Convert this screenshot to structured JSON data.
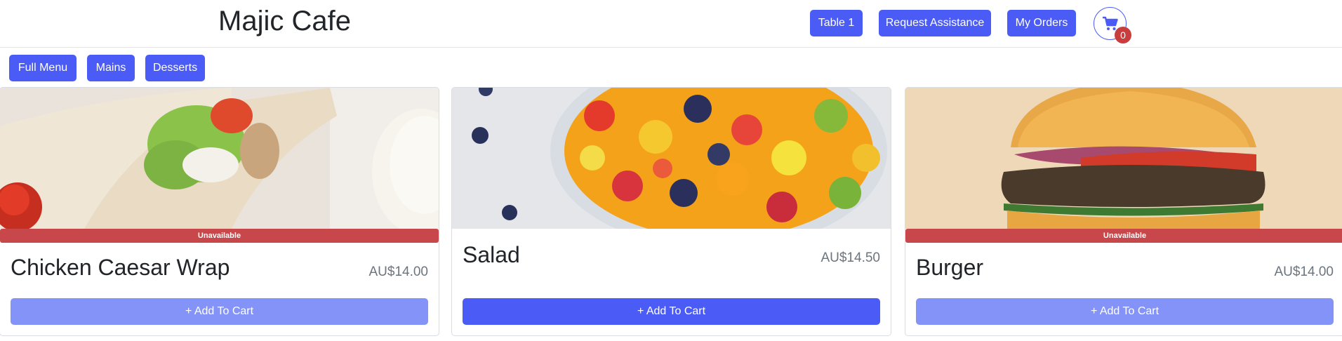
{
  "header": {
    "brand": "Majic Cafe",
    "buttons": {
      "table": "Table 1",
      "assist": "Request Assistance",
      "orders": "My Orders"
    },
    "cart": {
      "icon": "cart-icon",
      "count": "0"
    }
  },
  "filters": [
    "Full Menu",
    "Mains",
    "Desserts"
  ],
  "colors": {
    "primary": "#4a5cf5",
    "disabled": "#8493f7",
    "unavailable": "#c8474a"
  },
  "menu": [
    {
      "name": "Chicken Caesar Wrap",
      "price": "AU$14.00",
      "status": "Unavailable",
      "add_label": "+ Add To Cart",
      "image": "chicken-caesar-wrap-photo"
    },
    {
      "name": "Salad",
      "price": "AU$14.50",
      "status": "",
      "add_label": "+ Add To Cart",
      "image": "fruit-salad-photo"
    },
    {
      "name": "Burger",
      "price": "AU$14.00",
      "status": "Unavailable",
      "add_label": "+ Add To Cart",
      "image": "burger-photo"
    }
  ]
}
